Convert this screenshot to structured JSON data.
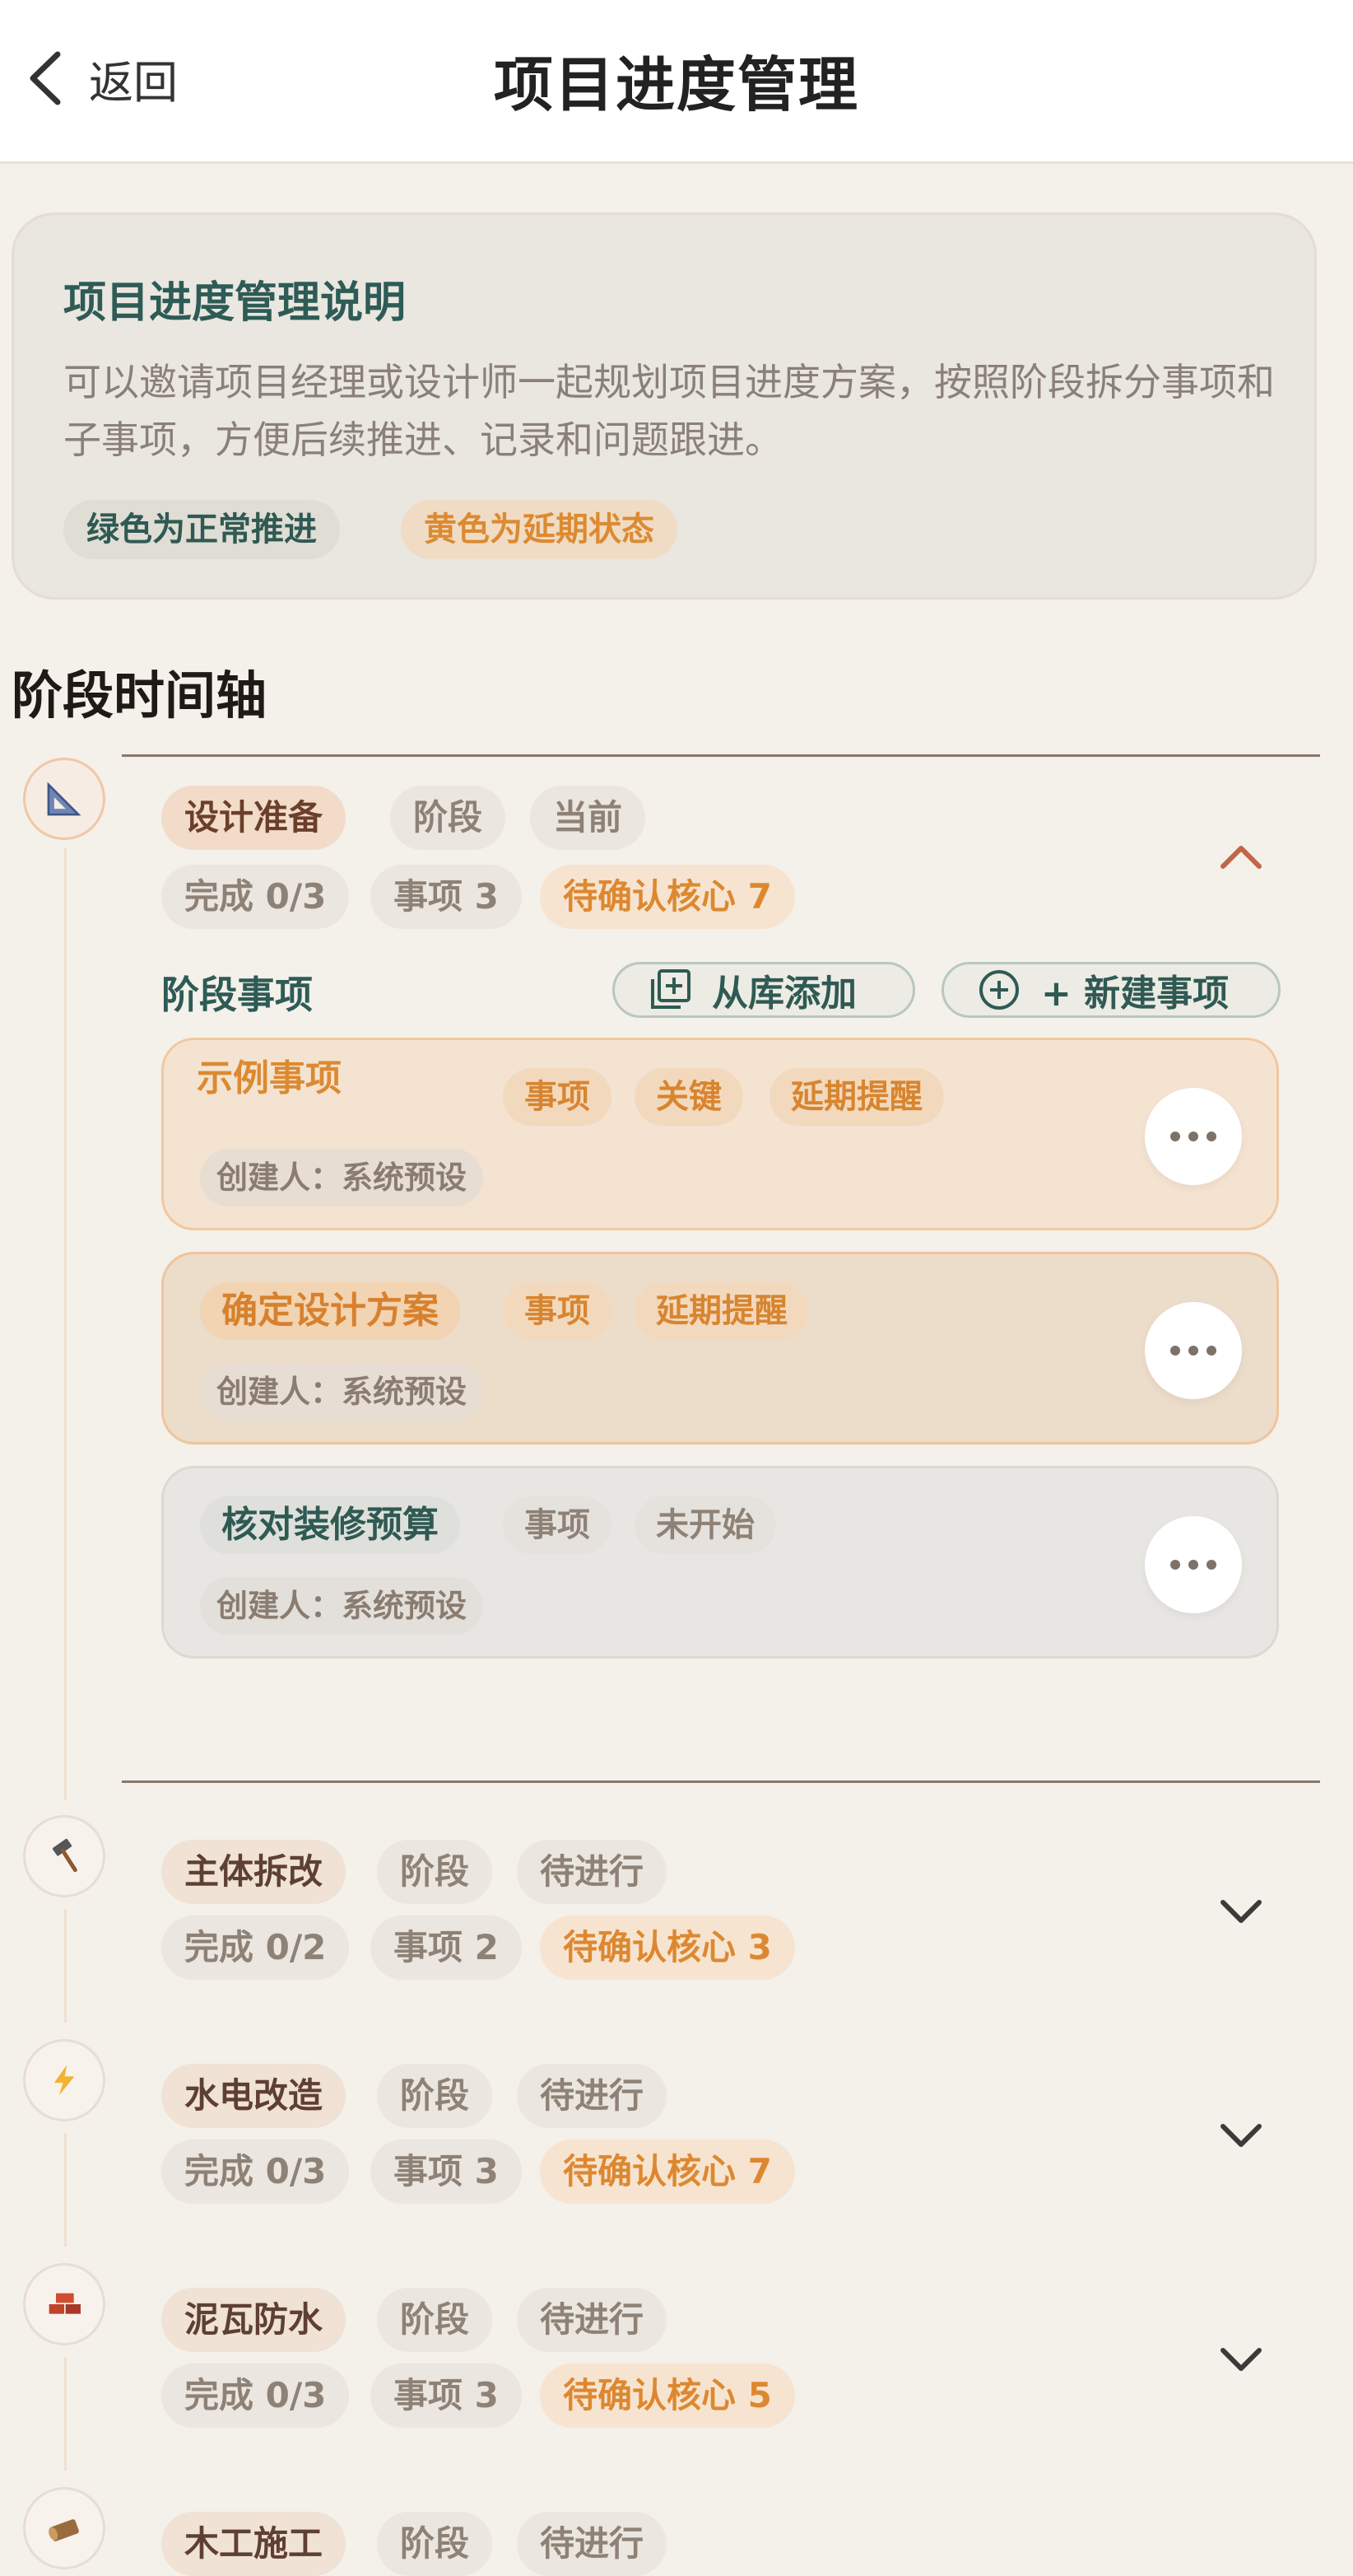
{
  "header": {
    "back_label": "返回",
    "title": "项目进度管理"
  },
  "intro": {
    "title": "项目进度管理说明",
    "description": "可以邀请项目经理或设计师一起规划项目进度方案，按照阶段拆分事项和子事项，方便后续推进、记录和问题跟进。",
    "tags": [
      "绿色为正常推进",
      "黄色为延期状态"
    ]
  },
  "timeline": {
    "title": "阶段时间轴",
    "stages": [
      {
        "icon": "triangle-ruler-icon",
        "glyph": "📐",
        "name": "设计准备",
        "type": "阶段",
        "status": "当前",
        "progress": "完成 0/3",
        "items": "事项 3",
        "pending": "待确认核心 7",
        "expanded": true
      },
      {
        "icon": "hammer-icon",
        "glyph": "🔨",
        "name": "主体拆改",
        "type": "阶段",
        "status": "待进行",
        "progress": "完成 0/2",
        "items": "事项 2",
        "pending": "待确认核心 3",
        "expanded": false
      },
      {
        "icon": "lightning-icon",
        "glyph": "⚡",
        "name": "水电改造",
        "type": "阶段",
        "status": "待进行",
        "progress": "完成 0/3",
        "items": "事项 3",
        "pending": "待确认核心 7",
        "expanded": false
      },
      {
        "icon": "bricks-icon",
        "glyph": "🧱",
        "name": "泥瓦防水",
        "type": "阶段",
        "status": "待进行",
        "progress": "完成 0/3",
        "items": "事项 3",
        "pending": "待确认核心 5",
        "expanded": false
      },
      {
        "icon": "wood-icon",
        "glyph": "🪵",
        "name": "木工施工",
        "type": "阶段",
        "status": "待进行"
      }
    ]
  },
  "stage_items": {
    "label": "阶段事项",
    "add_from_library": "从库添加",
    "new_item": "+ 新建事项",
    "cards": [
      {
        "overlay": "示例事项",
        "type": "事项",
        "flag": "关键",
        "alert": "延期提醒",
        "creator": "创建人：系统预设"
      },
      {
        "name": "确定设计方案",
        "type": "事项",
        "alert": "延期提醒",
        "creator": "创建人：系统预设"
      },
      {
        "name": "核对装修预算",
        "type": "事项",
        "status": "未开始",
        "creator": "创建人：系统预设"
      }
    ]
  },
  "colors": {
    "accent_green": "#2f5a53",
    "accent_orange": "#dd8830",
    "background": "#f4f0ea"
  }
}
